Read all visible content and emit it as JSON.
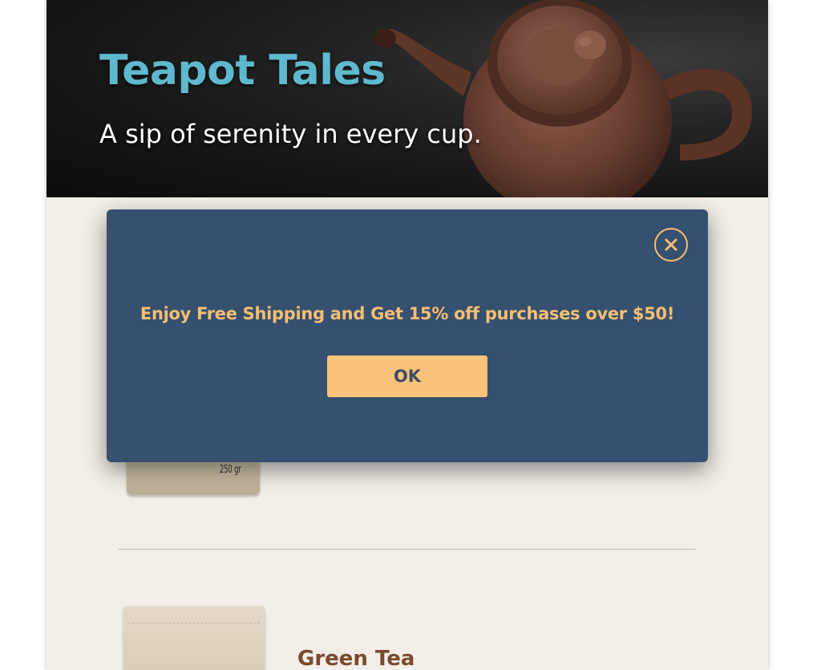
{
  "hero": {
    "title": "Teapot Tales",
    "tagline": "A sip of serenity in every cup."
  },
  "products": [
    {
      "weight_label": "250 gr"
    },
    {
      "name": "Green Tea"
    }
  ],
  "modal": {
    "message": "Enjoy Free Shipping and Get 15% off purchases over $50!",
    "ok_label": "OK",
    "close_icon": "close-icon"
  },
  "colors": {
    "modal_background": "#36506f",
    "accent": "#f6bf72",
    "ok_button": "#fbc27a",
    "title": "#5fb9ce",
    "product_name": "#7a4a2e",
    "page_background": "#f3eee7"
  }
}
